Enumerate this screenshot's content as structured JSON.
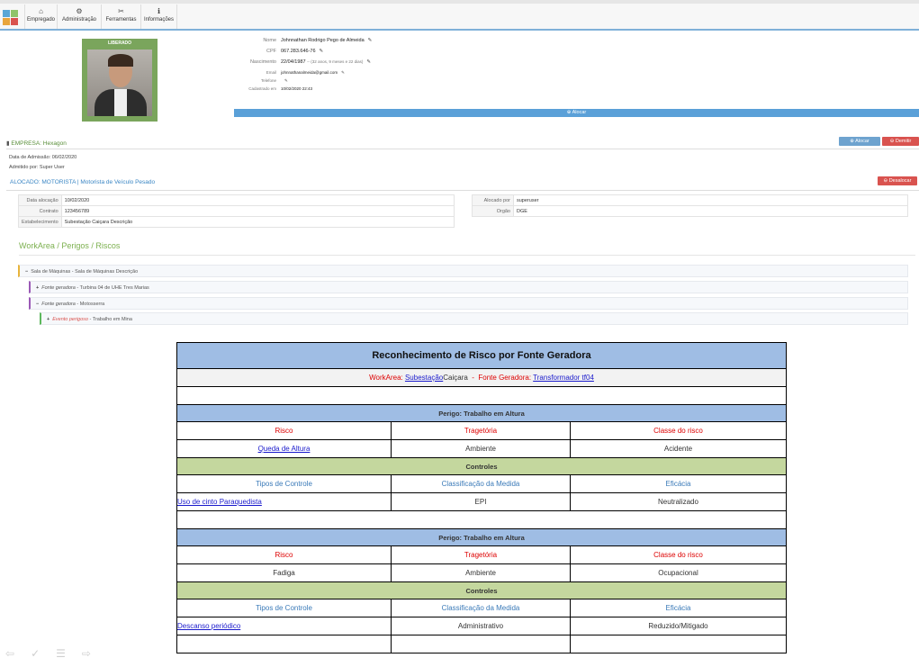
{
  "toolbar": {
    "items": [
      {
        "label": "Empregado",
        "icon": "home-icon"
      },
      {
        "label": "Administração",
        "icon": "gears-icon"
      },
      {
        "label": "Ferramentas",
        "icon": "wrench-icon"
      },
      {
        "label": "Informações",
        "icon": "info-icon"
      }
    ]
  },
  "profile": {
    "photo_tag": "LIBERADO",
    "fields": [
      {
        "label": "Nome",
        "value": "Johnnathan Rodrigo Pego de Almeida"
      },
      {
        "label": "CPF",
        "value": "067.283.646-76"
      },
      {
        "label": "Nascimento",
        "value": "22/04/1987",
        "extra": "-- (32 anos, 9 meses e 22 dias)"
      },
      {
        "label": "Email",
        "value": "johnnathanalmeida@gmail.com"
      },
      {
        "label": "Telefone",
        "value": ""
      },
      {
        "label": "Cadastrado em",
        "value": "10/02/2020 22:43"
      }
    ],
    "alocar_bar": "Alocar"
  },
  "empresa": {
    "title": "EMPRESA: Hexagon",
    "alocar_btn": "Alocar",
    "demitir_btn": "Demitir",
    "admissao": "Data de Admissão: 06/02/2020",
    "admitido_por": "Admitido por: Super User"
  },
  "alocado": {
    "title": "ALOCADO: MOTORISTA | Motorista de Veículo Pesado",
    "desalocar_btn": "Desalocar",
    "left": [
      {
        "k": "Data alocação",
        "v": "10/02/2020"
      },
      {
        "k": "Contrato",
        "v": "123456789"
      },
      {
        "k": "Estabelecimento",
        "v": "Subestação Caiçara Descrição"
      }
    ],
    "right": [
      {
        "k": "Alocado por",
        "v": "superuser"
      },
      {
        "k": "Orgão",
        "v": "DGE"
      }
    ]
  },
  "workarea": {
    "title": "WorkArea / Perigos / Riscos",
    "items": [
      {
        "sym": "−",
        "label": "Sala de Máquinas - Sala de Máquinas Descrição"
      },
      {
        "sym": "+",
        "label": "Fonte geradora",
        "rest": " - Turbina 04 de UHE Tres Marias"
      },
      {
        "sym": "−",
        "label": "Fonte geradora",
        "rest": " - Motosserra"
      },
      {
        "sym": "+",
        "label": "Evento perigoso",
        "rest": " - Trabalho em Mina"
      }
    ]
  },
  "report": {
    "title": "Reconhecimento de Risco por Fonte Geradora",
    "wa_label": "WorkArea:",
    "wa_link": "Subestação",
    "wa_rest": "Caiçara",
    "sep": "-",
    "fg_label": "Fonte Geradora:",
    "fg_link": "Transformador tf04",
    "headers": {
      "risco": "Risco",
      "trajetoria": "Tragetória",
      "classe": "Classe do risco",
      "controles": "Controles",
      "tipos": "Tipos de Controle",
      "classificacao": "Classificação da Medida",
      "eficacia": "Eficácia"
    },
    "blocks": [
      {
        "perigo": "Perigo: Trabalho em Altura",
        "risco": "Queda de Altura",
        "trajetoria": "Ambiente",
        "classe": "Acidente",
        "controle": "Uso de cinto Paraquedista",
        "classificacao": "EPI",
        "eficacia": "Neutralizado"
      },
      {
        "perigo": "Perigo: Trabalho em Altura",
        "risco": "Fadiga",
        "trajetoria": "Ambiente",
        "classe": "Ocupacional",
        "controle": "Descanso periódico",
        "classificacao": "Administrativo",
        "eficacia": "Reduzido/Mitigado"
      }
    ]
  }
}
